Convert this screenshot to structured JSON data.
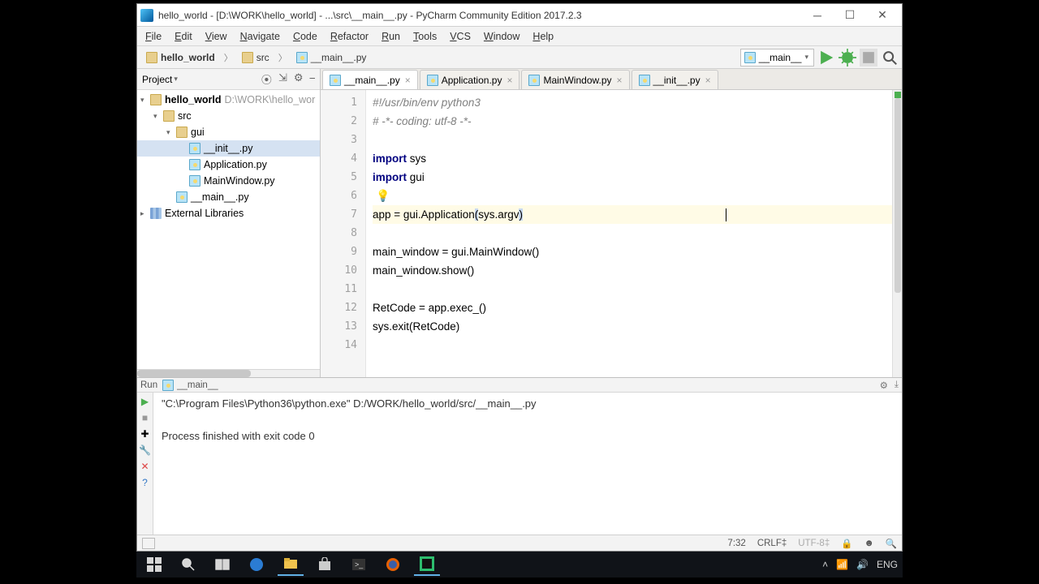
{
  "titlebar": {
    "title": "hello_world - [D:\\WORK\\hello_world] - ...\\src\\__main__.py - PyCharm Community Edition 2017.2.3"
  },
  "menu": [
    "File",
    "Edit",
    "View",
    "Navigate",
    "Code",
    "Refactor",
    "Run",
    "Tools",
    "VCS",
    "Window",
    "Help"
  ],
  "breadcrumbs": [
    {
      "label": "hello_world",
      "icon": "folder",
      "bold": true
    },
    {
      "label": "src",
      "icon": "folder"
    },
    {
      "label": "__main__.py",
      "icon": "py"
    }
  ],
  "run_config": {
    "label": "__main__"
  },
  "project": {
    "title": "Project",
    "tree": [
      {
        "level": 0,
        "arrow": "▾",
        "icon": "folder",
        "label": "hello_world",
        "path": "D:\\WORK\\hello_wor",
        "bold": true
      },
      {
        "level": 1,
        "arrow": "▾",
        "icon": "folder",
        "label": "src"
      },
      {
        "level": 2,
        "arrow": "▾",
        "icon": "folder",
        "label": "gui"
      },
      {
        "level": 3,
        "arrow": "",
        "icon": "py",
        "label": "__init__.py",
        "selected": true
      },
      {
        "level": 3,
        "arrow": "",
        "icon": "py",
        "label": "Application.py"
      },
      {
        "level": 3,
        "arrow": "",
        "icon": "py",
        "label": "MainWindow.py"
      },
      {
        "level": 2,
        "arrow": "",
        "icon": "py",
        "label": "__main__.py"
      },
      {
        "level": 0,
        "arrow": "▸",
        "icon": "bars",
        "label": "External Libraries"
      }
    ]
  },
  "tabs": [
    {
      "label": "__main__.py",
      "active": true
    },
    {
      "label": "Application.py"
    },
    {
      "label": "MainWindow.py"
    },
    {
      "label": "__init__.py"
    }
  ],
  "code": {
    "lines": [
      {
        "n": 1,
        "html": "<span class='cm-comment'>#!/usr/bin/env python3</span>"
      },
      {
        "n": 2,
        "html": "<span class='cm-comment'># -*- coding: utf-8 -*-</span>"
      },
      {
        "n": 3,
        "html": ""
      },
      {
        "n": 4,
        "html": "<span class='cm-kw'>import</span> sys"
      },
      {
        "n": 5,
        "html": "<span class='cm-kw'>import</span> gui"
      },
      {
        "n": 6,
        "html": "",
        "bulb": true
      },
      {
        "n": 7,
        "html": "app = gui.Application<span class='cm-br'>(</span>sys.argv<span class='cm-br'>)</span>",
        "hl": true,
        "caret": true
      },
      {
        "n": 8,
        "html": ""
      },
      {
        "n": 9,
        "html": "main_window = gui.MainWindow()"
      },
      {
        "n": 10,
        "html": "main_window.show()"
      },
      {
        "n": 11,
        "html": ""
      },
      {
        "n": 12,
        "html": "RetCode = app.exec_()"
      },
      {
        "n": 13,
        "html": "sys.exit(RetCode)"
      },
      {
        "n": 14,
        "html": ""
      }
    ]
  },
  "run": {
    "title": "Run",
    "config": "__main__",
    "output": [
      "\"C:\\Program Files\\Python36\\python.exe\" D:/WORK/hello_world/src/__main__.py",
      "",
      "Process finished with exit code 0"
    ]
  },
  "status": {
    "pos": "7:32",
    "eol": "CRLF‡",
    "enc": "UTF-8‡"
  },
  "tray": {
    "lang": "ENG"
  }
}
